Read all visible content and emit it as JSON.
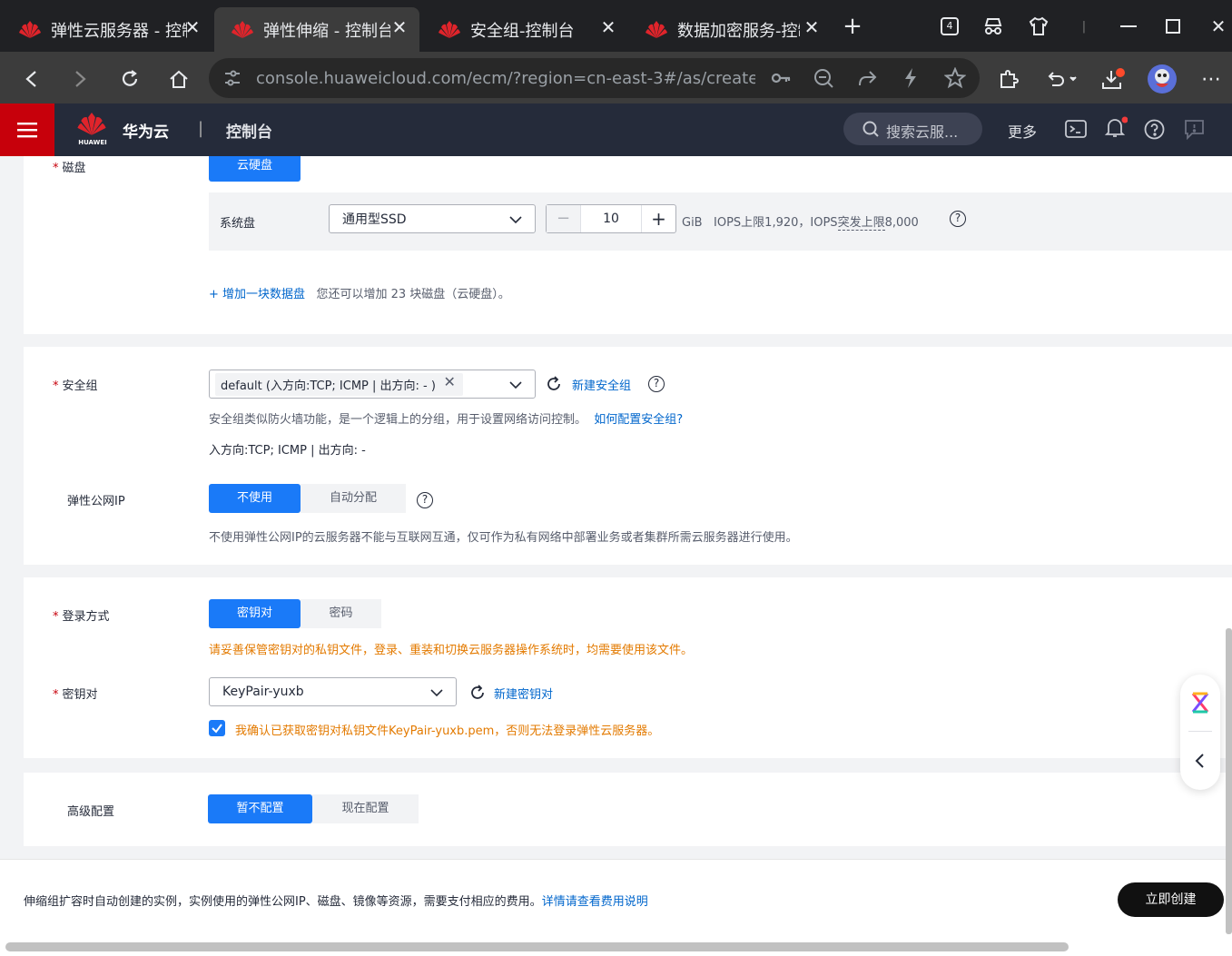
{
  "browser": {
    "tabs": [
      {
        "title": "弹性云服务器 - 控制台",
        "active": false
      },
      {
        "title": "弹性伸缩 - 控制台",
        "active": true
      },
      {
        "title": "安全组-控制台",
        "active": false
      },
      {
        "title": "数据加密服务-控制台",
        "active": false
      }
    ],
    "tab_count_badge": "4",
    "url": "console.huaweicloud.com/ecm/?region=cn-east-3#/as/create..."
  },
  "header": {
    "brand_logo_text": "HUAWEI",
    "brand": "华为云",
    "console": "控制台",
    "search_placeholder": "搜索云服...",
    "more": "更多"
  },
  "disk": {
    "label": "磁盘",
    "type_tab": "云硬盘",
    "system_disk_label": "系统盘",
    "system_disk_type": "通用型SSD",
    "size_value": "10",
    "unit": "GiB",
    "iops_text": "IOPS上限1,920，IOPS",
    "burst_text": "突发上限",
    "burst_value": "8,000",
    "add_link": "+ 增加一块数据盘",
    "add_hint": "您还可以增加 23 块磁盘（云硬盘）。"
  },
  "security_group": {
    "label": "安全组",
    "selected": "default (入方向:TCP; ICMP | 出方向: - )",
    "new_link": "新建安全组",
    "hint": "安全组类似防火墙功能，是一个逻辑上的分组，用于设置网络访问控制。",
    "help_link": "如何配置安全组?",
    "rules_summary": "入方向:TCP; ICMP | 出方向: -"
  },
  "eip": {
    "label": "弹性公网IP",
    "options": [
      "不使用",
      "自动分配"
    ],
    "selected_index": 0,
    "hint": "不使用弹性公网IP的云服务器不能与互联网互通，仅可作为私有网络中部署业务或者集群所需云服务器进行使用。"
  },
  "login": {
    "label": "登录方式",
    "options": [
      "密钥对",
      "密码"
    ],
    "selected_index": 0,
    "warning": "请妥善保管密钥对的私钥文件，登录、重装和切换云服务器操作系统时，均需要使用该文件。"
  },
  "keypair": {
    "label": "密钥对",
    "selected": "KeyPair-yuxb",
    "new_link": "新建密钥对",
    "confirm_text": "我确认已获取密钥对私钥文件KeyPair-yuxb.pem，否则无法登录弹性云服务器。",
    "confirm_checked": true
  },
  "advanced": {
    "label": "高级配置",
    "options": [
      "暂不配置",
      "现在配置"
    ],
    "selected_index": 0
  },
  "footer": {
    "notice": "伸缩组扩容时自动创建的实例，实例使用的弹性公网IP、磁盘、镜像等资源，需要支付相应的费用。",
    "fee_link": "详情请查看费用说明",
    "create_button": "立即创建"
  },
  "colors": {
    "primary": "#1a7af8",
    "huawei_red": "#c7000b",
    "header_bg": "#252b3a",
    "warning": "#e37a00",
    "link": "#0066cc"
  }
}
